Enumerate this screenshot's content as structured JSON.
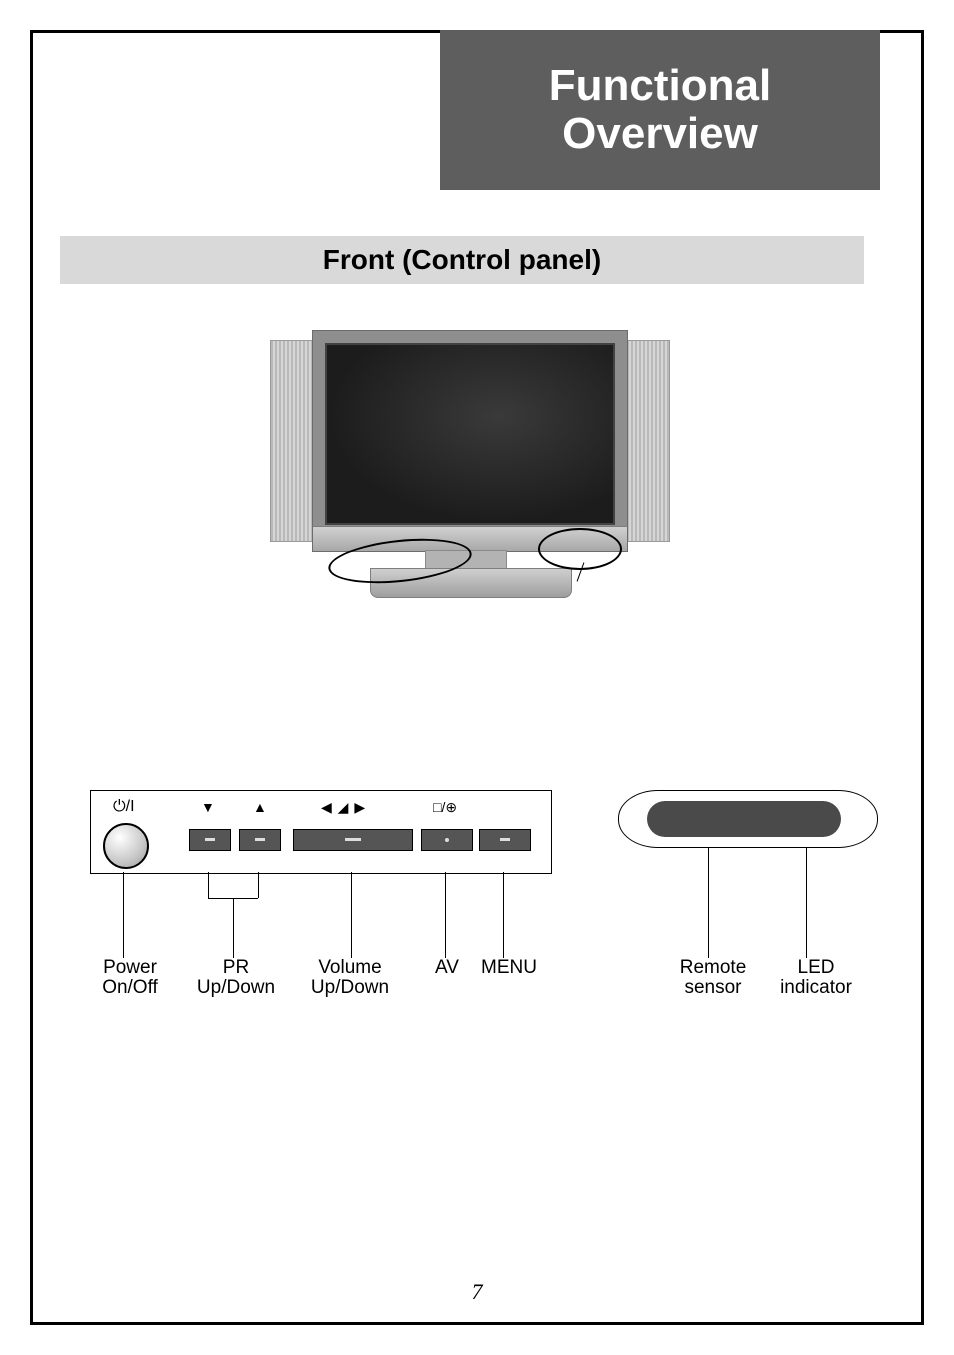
{
  "header": {
    "line1": "Functional",
    "line2": "Overview"
  },
  "section": {
    "title": "Front (Control panel)"
  },
  "controls": {
    "symbols": {
      "power": "⏻/I",
      "down": "▼",
      "up": "▲",
      "volume": "◀ ◢ ▶",
      "av_menu": "□/⊕"
    },
    "labels": {
      "power_l1": "Power",
      "power_l2": "On/Off",
      "pr_l1": "PR",
      "pr_l2": "Up/Down",
      "vol_l1": "Volume",
      "vol_l2": "Up/Down",
      "av": "AV",
      "menu": "MENU"
    }
  },
  "sensor": {
    "remote_l1": "Remote",
    "remote_l2": "sensor",
    "led_l1": "LED",
    "led_l2": "indicator"
  },
  "page_number": "7"
}
